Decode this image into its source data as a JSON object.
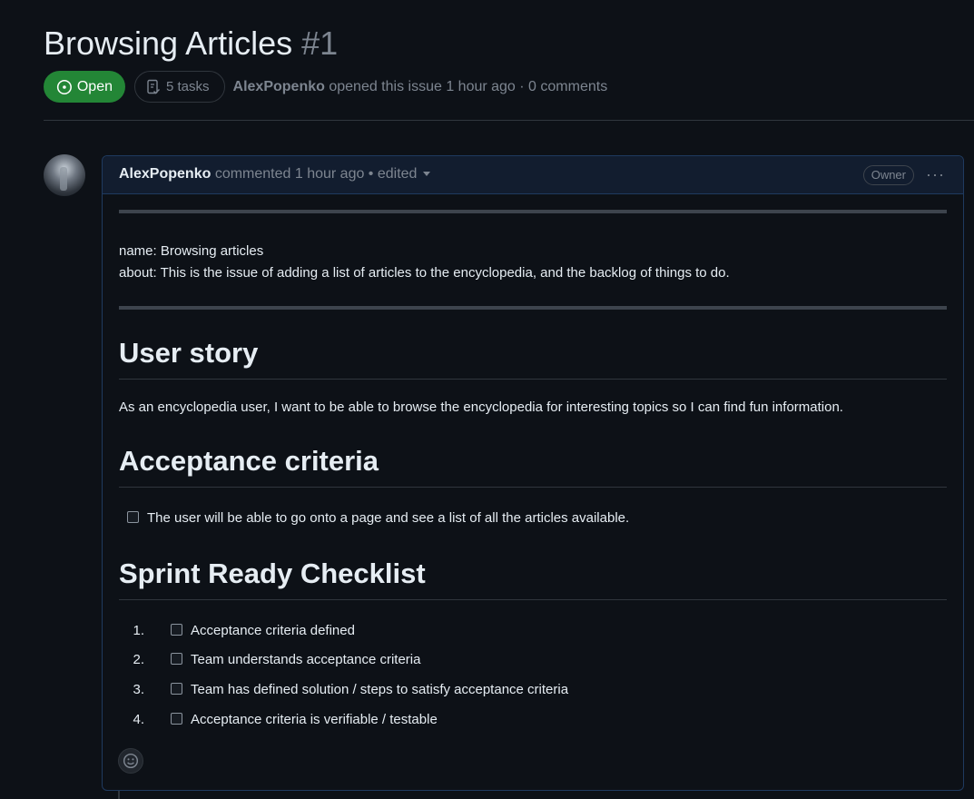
{
  "issue": {
    "title": "Browsing Articles",
    "number": "#1",
    "state": "Open",
    "tasks": "5 tasks",
    "author": "AlexPopenko",
    "meta_rest": "opened this issue 1 hour ago · 0 comments"
  },
  "comment": {
    "author": "AlexPopenko",
    "meta": "commented 1 hour ago • edited",
    "role": "Owner",
    "more": "···",
    "frontmatter_name": "name: Browsing articles",
    "frontmatter_about": "about: This is the issue of adding a list of articles to the encyclopedia, and the backlog of things to do.",
    "sections": {
      "user_story_heading": "User story",
      "user_story_text": "As an encyclopedia user, I want to be able to browse the encyclopedia for interesting topics so I can find fun information.",
      "acceptance_heading": "Acceptance criteria",
      "acceptance_item": "The user will be able to go onto a page and see a list of all the articles available.",
      "checklist_heading": "Sprint Ready Checklist",
      "checklist": [
        {
          "num": "1.",
          "label": "Acceptance criteria defined"
        },
        {
          "num": "2.",
          "label": "Team understands acceptance criteria"
        },
        {
          "num": "3.",
          "label": "Team has defined solution / steps to satisfy acceptance criteria"
        },
        {
          "num": "4.",
          "label": "Acceptance criteria is verifiable / testable"
        }
      ]
    }
  },
  "colors": {
    "open_green": "#238636",
    "background": "#0d1117",
    "header_blue": "#121d2f"
  },
  "icons": [
    "issue-opened-icon",
    "tasklist-icon",
    "kebab-horizontal-icon",
    "smiley-icon",
    "triangle-down-icon"
  ]
}
